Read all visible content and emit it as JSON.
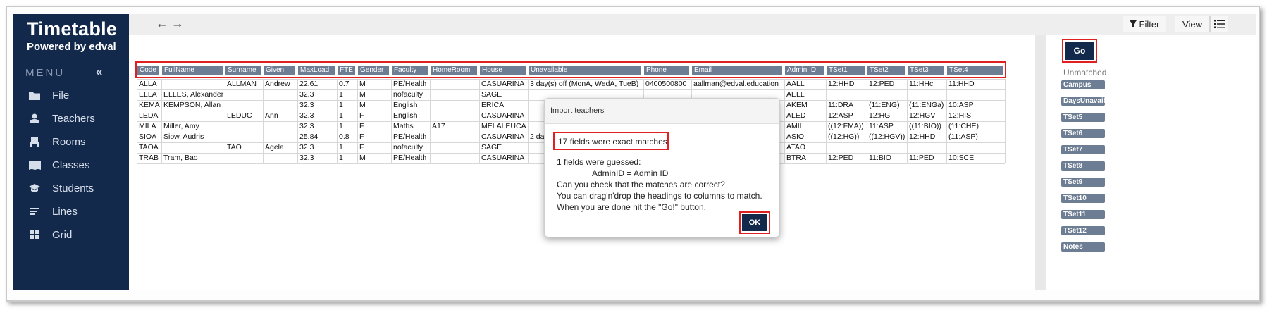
{
  "sidebar": {
    "logo_title": "Timetable",
    "logo_sub": "Powered by edval",
    "menu_label": "MENU",
    "collapse_glyph": "«",
    "items": [
      {
        "label": "File",
        "icon": "folder-icon"
      },
      {
        "label": "Teachers",
        "icon": "person-icon"
      },
      {
        "label": "Rooms",
        "icon": "chair-icon"
      },
      {
        "label": "Classes",
        "icon": "book-icon"
      },
      {
        "label": "Students",
        "icon": "graduation-cap-icon"
      },
      {
        "label": "Lines",
        "icon": "lines-icon"
      },
      {
        "label": "Grid",
        "icon": "grid-icon"
      }
    ]
  },
  "topbar": {
    "back_glyph": "←",
    "forward_glyph": "→",
    "filter_label": "Filter",
    "view_label": "View"
  },
  "right_panel": {
    "go_label": "Go",
    "unmatched_label": "Unmatched",
    "unmatched_chips": [
      "Campus",
      "DaysUnavail",
      "TSet5",
      "TSet6",
      "TSet7",
      "TSet8",
      "TSet9",
      "TSet10",
      "TSet11",
      "TSet12",
      "Notes"
    ]
  },
  "table": {
    "headers": [
      "Code",
      "FullName",
      "Surname",
      "Given",
      "MaxLoad",
      "FTE",
      "Gender",
      "Faculty",
      "HomeRoom",
      "House",
      "Unavailable",
      "Phone",
      "Email",
      "Admin ID",
      "TSet1",
      "TSet2",
      "TSet3",
      "TSet4"
    ],
    "rows": [
      [
        "ALLA",
        "",
        "ALLMAN",
        "Andrew",
        "22.61",
        "0.7",
        "M",
        "PE/Health",
        "",
        "CASUARINA",
        "3 day(s) off (MonA, WedA, TueB)",
        "0400500800",
        "aallman@edval.education",
        "AALL",
        "12:HHD",
        "12:PED",
        "11:HHc",
        "11:HHD"
      ],
      [
        "ELLA",
        "ELLES, Alexander",
        "",
        "",
        "32.3",
        "1",
        "M",
        "nofaculty",
        "",
        "SAGE",
        "",
        "",
        "",
        "AELL",
        "",
        "",
        "",
        ""
      ],
      [
        "KEMA",
        "KEMPSON, Allan",
        "",
        "",
        "32.3",
        "1",
        "M",
        "English",
        "",
        "ERICA",
        "",
        "",
        "",
        "AKEM",
        "11:DRA",
        "(11:ENG)",
        "(11:ENGa)",
        "10:ASP"
      ],
      [
        "LEDA",
        "",
        "LEDUC",
        "Ann",
        "32.3",
        "1",
        "F",
        "English",
        "",
        "CASUARINA",
        "",
        "",
        "",
        "ALED",
        "12:ASP",
        "12:HG",
        "12:HGV",
        "12:HIS"
      ],
      [
        "MILA",
        "Miller, Amy",
        "",
        "",
        "32.3",
        "1",
        "F",
        "Maths",
        "A17",
        "MELALEUCA",
        "",
        "",
        "",
        "AMIL",
        "((12:FMA))",
        "11:ASP",
        "((11:BIO))",
        "(11:CHE)"
      ],
      [
        "SIOA",
        "Siow, Audris",
        "",
        "",
        "25.84",
        "0.8",
        "F",
        "PE/Health",
        "",
        "CASUARINA",
        "2 da",
        "",
        "",
        "ASIO",
        "((12:HG))",
        "((12:HGV))",
        "12:HHD",
        "(11:ASP)"
      ],
      [
        "TAOA",
        "",
        "TAO",
        "Agela",
        "32.3",
        "1",
        "F",
        "nofaculty",
        "",
        "SAGE",
        "",
        "",
        "",
        "ATAO",
        "",
        "",
        "",
        ""
      ],
      [
        "TRAB",
        "Tram, Bao",
        "",
        "",
        "32.3",
        "1",
        "M",
        "PE/Health",
        "",
        "CASUARINA",
        "",
        "",
        "",
        "BTRA",
        "12:PED",
        "11:BIO",
        "11:PED",
        "10:SCE"
      ]
    ]
  },
  "modal": {
    "title": "Import teachers",
    "exact": "17 fields were exact matches",
    "guessed": "1 fields were guessed:",
    "mapping": "AdminID = Admin ID",
    "check": "Can you check that the matches are correct?",
    "drag": "You can drag'n'drop the headings to columns to match.",
    "done": "When you are done hit the \"Go!\" button.",
    "ok_label": "OK"
  },
  "colors": {
    "sidebar_bg": "#13294b",
    "header_chip": "#6d7d93",
    "highlight_border": "#e02020"
  }
}
